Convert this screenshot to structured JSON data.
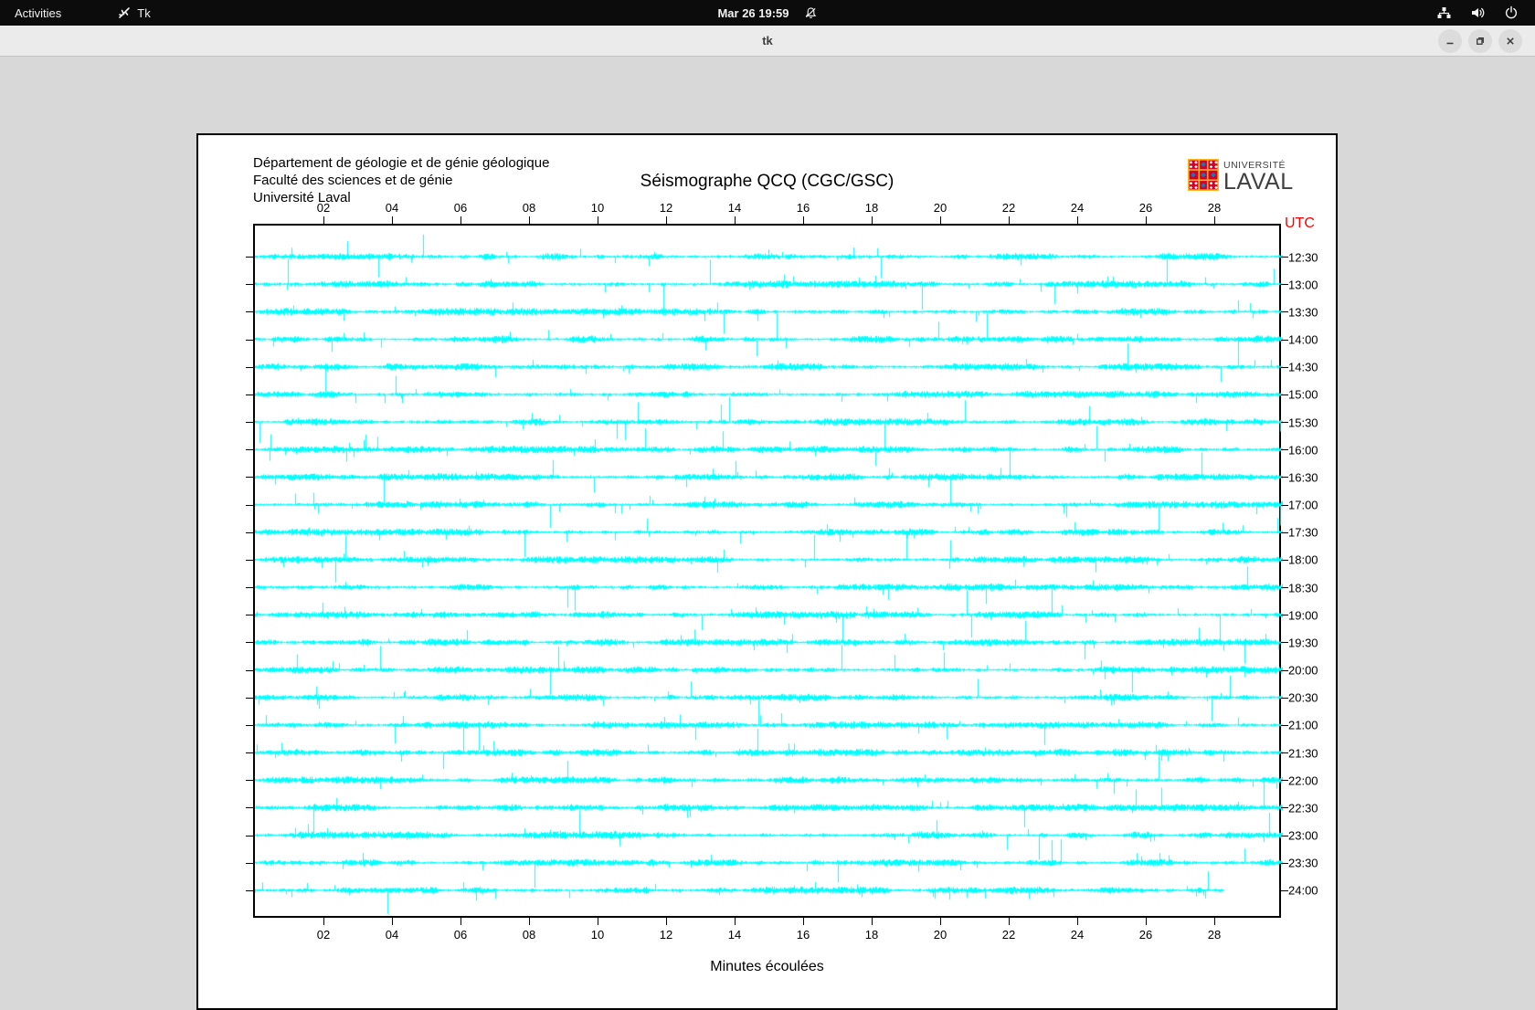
{
  "topbar": {
    "activities_label": "Activities",
    "app_indicator": "Tk",
    "clock": "Mar 26 19:59"
  },
  "titlebar": {
    "title": "tk"
  },
  "window": {
    "header": {
      "address_lines": [
        "Département de géologie et de génie géologique",
        "Faculté des sciences et de génie",
        "Université Laval"
      ],
      "logo": {
        "line1": "UNIVERSITÉ",
        "line2": "LAVAL"
      }
    }
  },
  "chart_data": {
    "type": "line",
    "title": "Séismographe QCQ (CGC/GSC)",
    "xlabel": "Minutes écoulées",
    "right_axis_title": "UTC",
    "right_axis_title_color": "#ff0000",
    "trace_color": "#00ffff",
    "x_range_minutes": [
      0,
      30
    ],
    "x_tick_minutes": [
      2,
      4,
      6,
      8,
      10,
      12,
      14,
      16,
      18,
      20,
      22,
      24,
      26,
      28
    ],
    "x_tick_labels": [
      "02",
      "04",
      "06",
      "08",
      "10",
      "12",
      "14",
      "16",
      "18",
      "20",
      "22",
      "24",
      "26",
      "28"
    ],
    "traces": [
      {
        "label": "12:30",
        "start_min": 0,
        "end_min": 30
      },
      {
        "label": "13:00",
        "start_min": 0,
        "end_min": 30
      },
      {
        "label": "13:30",
        "start_min": 0,
        "end_min": 30
      },
      {
        "label": "14:00",
        "start_min": 0,
        "end_min": 30
      },
      {
        "label": "14:30",
        "start_min": 0,
        "end_min": 30
      },
      {
        "label": "15:00",
        "start_min": 0,
        "end_min": 30
      },
      {
        "label": "15:30",
        "start_min": 0,
        "end_min": 30
      },
      {
        "label": "16:00",
        "start_min": 0,
        "end_min": 30
      },
      {
        "label": "16:30",
        "start_min": 0,
        "end_min": 30
      },
      {
        "label": "17:00",
        "start_min": 0,
        "end_min": 30
      },
      {
        "label": "17:30",
        "start_min": 0,
        "end_min": 30
      },
      {
        "label": "18:00",
        "start_min": 0,
        "end_min": 30
      },
      {
        "label": "18:30",
        "start_min": 0,
        "end_min": 30
      },
      {
        "label": "19:00",
        "start_min": 0,
        "end_min": 30
      },
      {
        "label": "19:30",
        "start_min": 0,
        "end_min": 30
      },
      {
        "label": "20:00",
        "start_min": 0,
        "end_min": 30
      },
      {
        "label": "20:30",
        "start_min": 0,
        "end_min": 30
      },
      {
        "label": "21:00",
        "start_min": 0,
        "end_min": 30
      },
      {
        "label": "21:30",
        "start_min": 0,
        "end_min": 30
      },
      {
        "label": "22:00",
        "start_min": 0,
        "end_min": 30
      },
      {
        "label": "22:30",
        "start_min": 0,
        "end_min": 30
      },
      {
        "label": "23:00",
        "start_min": 0,
        "end_min": 30
      },
      {
        "label": "23:30",
        "start_min": 0,
        "end_min": 30
      },
      {
        "label": "24:00",
        "start_min": 0,
        "end_min": 28.3
      }
    ]
  }
}
